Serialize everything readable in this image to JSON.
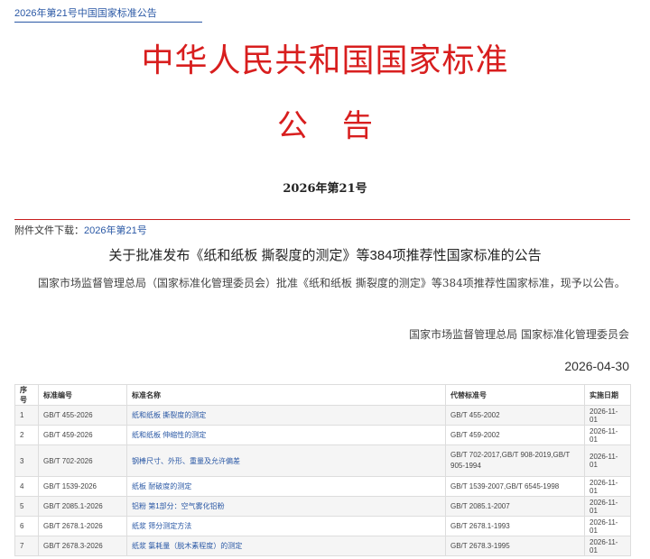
{
  "breadcrumb": "2026年第21号中国国家标准公告",
  "headline_main": "中华人民共和国国家标准",
  "headline_sub": "公告",
  "notice_number": "2026年第21号",
  "attachment": {
    "label": "附件文件下载：",
    "link": "2026年第21号"
  },
  "title": "关于批准发布《纸和纸板 撕裂度的测定》等384项推荐性国家标准的公告",
  "body": "国家市场监督管理总局（国家标准化管理委员会）批准《纸和纸板 撕裂度的测定》等384项推荐性国家标准，现予以公告。",
  "issuer": "国家市场监督管理总局 国家标准化管理委员会",
  "date": "2026-04-30",
  "table": {
    "headers": [
      "序号",
      "标准编号",
      "标准名称",
      "代替标准号",
      "实施日期"
    ],
    "rows": [
      [
        "1",
        "GB/T 455-2026",
        "纸和纸板 撕裂度的测定",
        "GB/T 455-2002",
        "2026-11-01"
      ],
      [
        "2",
        "GB/T 459-2026",
        "纸和纸板 伸缩性的测定",
        "GB/T 459-2002",
        "2026-11-01"
      ],
      [
        "3",
        "GB/T 702-2026",
        "钢棒尺寸、外形、重量及允许偏差",
        "GB/T 702-2017,GB/T 908-2019,GB/T 905-1994",
        "2026-11-01"
      ],
      [
        "4",
        "GB/T 1539-2026",
        "纸板 耐破度的测定",
        "GB/T 1539-2007,GB/T 6545-1998",
        "2026-11-01"
      ],
      [
        "5",
        "GB/T 2085.1-2026",
        "铝粉 第1部分：空气雾化铝粉",
        "GB/T 2085.1-2007",
        "2026-11-01"
      ],
      [
        "6",
        "GB/T 2678.1-2026",
        "纸浆 筛分测定方法",
        "GB/T 2678.1-1993",
        "2026-11-01"
      ],
      [
        "7",
        "GB/T 2678.3-2026",
        "纸浆 氯耗量（脱木素程度）的测定",
        "GB/T 2678.3-1995",
        "2026-11-01"
      ]
    ]
  }
}
